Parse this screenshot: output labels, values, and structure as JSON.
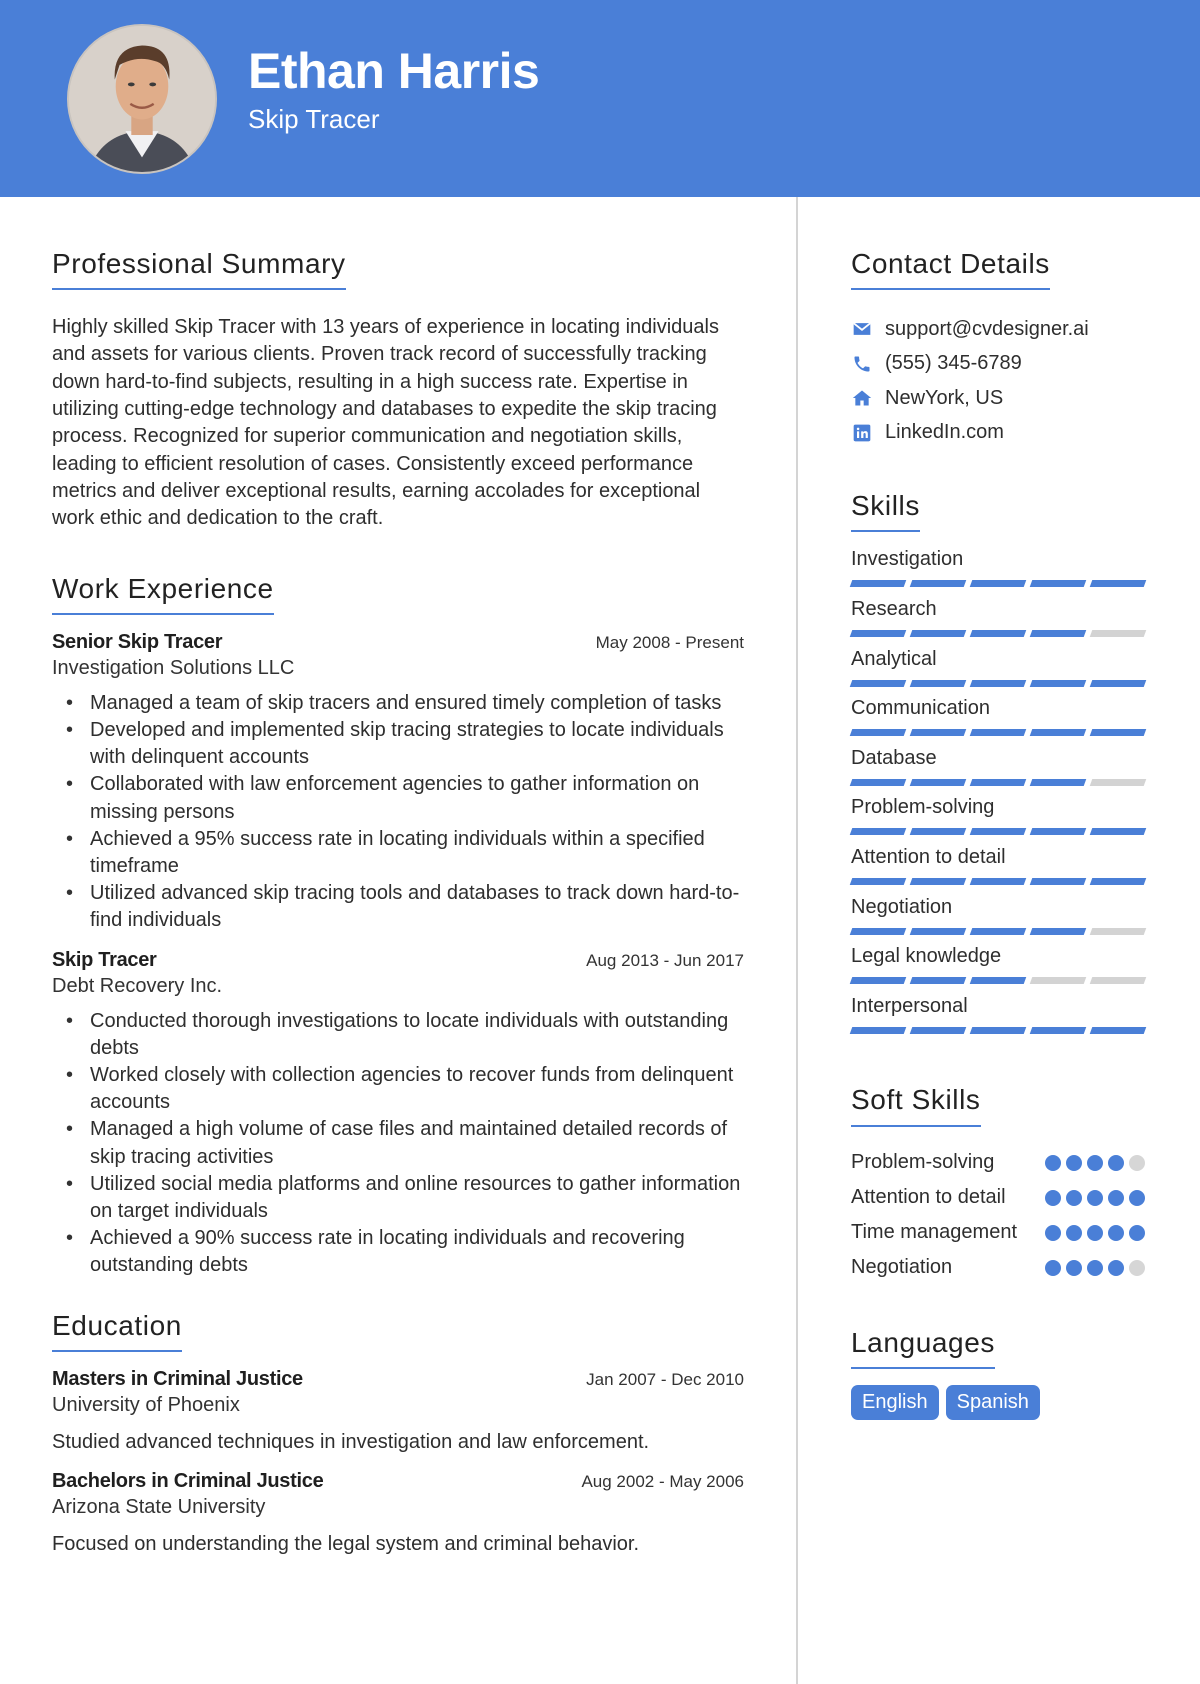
{
  "header": {
    "name": "Ethan Harris",
    "title": "Skip Tracer",
    "accent_color": "#4a7fd7",
    "photo_alt": "Profile photo"
  },
  "summary": {
    "heading": "Professional Summary",
    "text": "Highly skilled Skip Tracer with 13 years of experience in locating individuals and assets for various clients. Proven track record of successfully tracking down hard-to-find subjects, resulting in a high success rate. Expertise in utilizing cutting-edge technology and databases to expedite the skip tracing process. Recognized for superior communication and negotiation skills, leading to efficient resolution of cases. Consistently exceed performance metrics and deliver exceptional results, earning accolades for exceptional work ethic and dedication to the craft."
  },
  "experience": {
    "heading": "Work Experience",
    "jobs": [
      {
        "role": "Senior Skip Tracer",
        "dates": "May 2008 - Present",
        "company": "Investigation Solutions LLC",
        "bullets": [
          "Managed a team of skip tracers and ensured timely completion of tasks",
          "Developed and implemented skip tracing strategies to locate individuals with delinquent accounts",
          "Collaborated with law enforcement agencies to gather information on missing persons",
          "Achieved a 95% success rate in locating individuals within a specified timeframe",
          "Utilized advanced skip tracing tools and databases to track down hard-to-find individuals"
        ]
      },
      {
        "role": "Skip Tracer",
        "dates": "Aug 2013 - Jun 2017",
        "company": "Debt Recovery Inc.",
        "bullets": [
          "Conducted thorough investigations to locate individuals with outstanding debts",
          "Worked closely with collection agencies to recover funds from delinquent accounts",
          "Managed a high volume of case files and maintained detailed records of skip tracing activities",
          "Utilized social media platforms and online resources to gather information on target individuals",
          "Achieved a 90% success rate in locating individuals and recovering outstanding debts"
        ]
      }
    ]
  },
  "education": {
    "heading": "Education",
    "items": [
      {
        "degree": "Masters in Criminal Justice",
        "dates": "Jan 2007 - Dec 2010",
        "school": "University of Phoenix",
        "description": "Studied advanced techniques in investigation and law enforcement."
      },
      {
        "degree": "Bachelors in Criminal Justice",
        "dates": "Aug 2002 - May 2006",
        "school": "Arizona State University",
        "description": "Focused on understanding the legal system and criminal behavior."
      }
    ]
  },
  "contact": {
    "heading": "Contact Details",
    "items": [
      {
        "icon": "envelope-icon",
        "text": "support@cvdesigner.ai"
      },
      {
        "icon": "phone-icon",
        "text": "(555) 345-6789"
      },
      {
        "icon": "home-icon",
        "text": "NewYork, US"
      },
      {
        "icon": "linkedin-icon",
        "text": "LinkedIn.com"
      }
    ]
  },
  "skills": {
    "heading": "Skills",
    "max_level": 5,
    "items": [
      {
        "name": "Investigation",
        "level": 5
      },
      {
        "name": "Research",
        "level": 4
      },
      {
        "name": "Analytical",
        "level": 5
      },
      {
        "name": "Communication",
        "level": 5
      },
      {
        "name": "Database",
        "level": 4
      },
      {
        "name": "Problem-solving",
        "level": 5
      },
      {
        "name": "Attention to detail",
        "level": 5
      },
      {
        "name": "Negotiation",
        "level": 4
      },
      {
        "name": "Legal knowledge",
        "level": 3
      },
      {
        "name": "Interpersonal",
        "level": 5
      }
    ]
  },
  "soft_skills": {
    "heading": "Soft Skills",
    "max_level": 5,
    "items": [
      {
        "name": "Problem-solving",
        "level": 4
      },
      {
        "name": "Attention to detail",
        "level": 5
      },
      {
        "name": "Time management",
        "level": 5
      },
      {
        "name": "Negotiation",
        "level": 4
      }
    ]
  },
  "languages": {
    "heading": "Languages",
    "items": [
      "English",
      "Spanish"
    ]
  }
}
